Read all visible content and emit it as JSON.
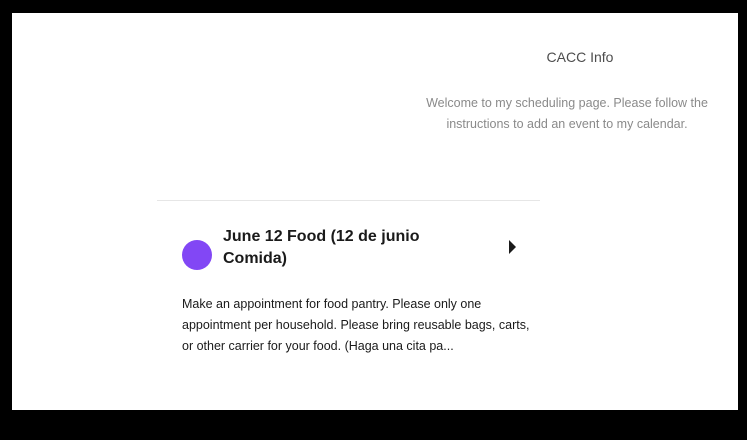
{
  "profile": {
    "name": "CACC Info",
    "welcome": "Welcome to my scheduling page. Please follow the instructions to add an event to my calendar."
  },
  "event": {
    "title": "June 12 Food (12 de junio Comida)",
    "dot_color": "#8247f5",
    "description": "Make an appointment for food pantry. Please only one appointment per household. Please bring reusable bags, carts, or other carrier for your food. (Haga una cita pa..."
  },
  "icons": {
    "arrow": "caret-right-icon"
  }
}
